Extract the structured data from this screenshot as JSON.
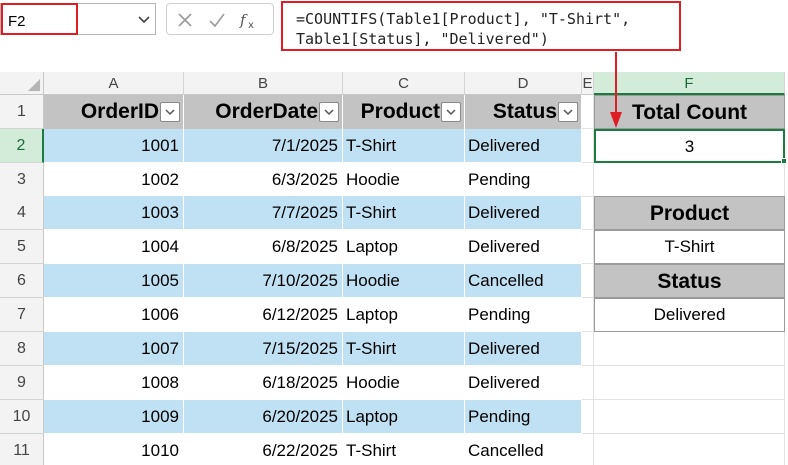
{
  "name_box": {
    "value": "F2"
  },
  "formula_bar": {
    "line1": "=COUNTIFS(Table1[Product], \"T-Shirt\",",
    "line2": "Table1[Status], \"Delivered\")"
  },
  "columns": [
    "A",
    "B",
    "C",
    "D",
    "E",
    "F"
  ],
  "rows": [
    "1",
    "2",
    "3",
    "4",
    "5",
    "6",
    "7",
    "8",
    "9",
    "10",
    "11"
  ],
  "table": {
    "headers": [
      "OrderID",
      "OrderDate",
      "Product",
      "Status"
    ],
    "data": [
      [
        "1001",
        "7/1/2025",
        "T-Shirt",
        "Delivered"
      ],
      [
        "1002",
        "6/3/2025",
        "Hoodie",
        "Pending"
      ],
      [
        "1003",
        "7/7/2025",
        "T-Shirt",
        "Delivered"
      ],
      [
        "1004",
        "6/8/2025",
        "Laptop",
        "Delivered"
      ],
      [
        "1005",
        "7/10/2025",
        "Hoodie",
        "Cancelled"
      ],
      [
        "1006",
        "6/12/2025",
        "Laptop",
        "Pending"
      ],
      [
        "1007",
        "7/15/2025",
        "T-Shirt",
        "Delivered"
      ],
      [
        "1008",
        "6/18/2025",
        "Hoodie",
        "Delivered"
      ],
      [
        "1009",
        "6/20/2025",
        "Laptop",
        "Pending"
      ],
      [
        "1010",
        "6/22/2025",
        "T-Shirt",
        "Cancelled"
      ]
    ]
  },
  "side_panel": {
    "total_label": "Total Count",
    "total_value": "3",
    "product_label": "Product",
    "product_value": "T-Shirt",
    "status_label": "Status",
    "status_value": "Delivered"
  },
  "colors": {
    "accent_red": "#e01c24",
    "selection_green": "#1e7b40",
    "band_blue": "#c0e0f4",
    "header_gray": "#c3c3c3"
  },
  "icons": [
    "chevron-down-icon",
    "cancel-icon",
    "check-icon",
    "fx-icon",
    "filter-dropdown-icon"
  ]
}
